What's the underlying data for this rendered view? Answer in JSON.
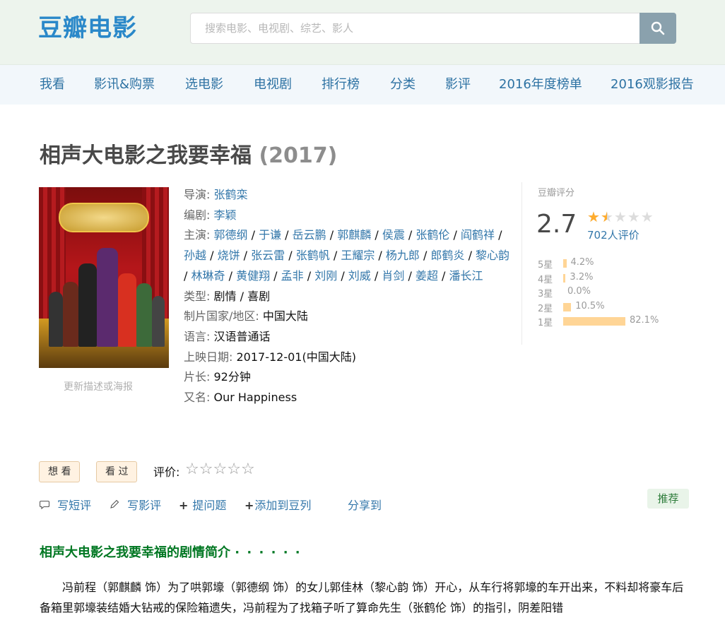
{
  "header": {
    "logo": "豆瓣电影",
    "search_placeholder": "搜索电影、电视剧、综艺、影人"
  },
  "nav": {
    "items": [
      "我看",
      "影讯&购票",
      "选电影",
      "电视剧",
      "排行榜",
      "分类",
      "影评",
      "2016年度榜单",
      "2016观影报告"
    ]
  },
  "movie": {
    "title": "相声大电影之我要幸福",
    "year": "(2017)",
    "update_link": "更新描述或海报"
  },
  "info": {
    "director_label": "导演",
    "director": "张鹤栾",
    "writer_label": "编剧",
    "writer": "李颖",
    "cast_label": "主演",
    "cast": [
      "郭德纲",
      "于谦",
      "岳云鹏",
      "郭麒麟",
      "侯震",
      "张鹤伦",
      "阎鹤祥",
      "孙越",
      "烧饼",
      "张云雷",
      "张鹤帆",
      "王耀宗",
      "杨九郎",
      "郎鹤炎",
      "黎心韵",
      "林琳奇",
      "黄健翔",
      "孟非",
      "刘刚",
      "刘威",
      "肖剑",
      "姜超",
      "潘长江"
    ],
    "genre_label": "类型:",
    "genre": "剧情 / 喜剧",
    "country_label": "制片国家/地区:",
    "country": "中国大陆",
    "language_label": "语言:",
    "language": "汉语普通话",
    "release_label": "上映日期:",
    "release": "2017-12-01(中国大陆)",
    "runtime_label": "片长:",
    "runtime": "92分钟",
    "aka_label": "又名:",
    "aka": "Our Happiness"
  },
  "rating": {
    "label": "豆瓣评分",
    "score": "2.7",
    "stars_value": 1.5,
    "stars_max": 5,
    "votes": "702人评价",
    "breakdown": [
      {
        "star": "5星",
        "pct": "4.2%",
        "value": 4.2
      },
      {
        "star": "4星",
        "pct": "3.2%",
        "value": 3.2
      },
      {
        "star": "3星",
        "pct": "0.0%",
        "value": 0.0
      },
      {
        "star": "2星",
        "pct": "10.5%",
        "value": 10.5
      },
      {
        "star": "1星",
        "pct": "82.1%",
        "value": 82.1
      }
    ]
  },
  "actions": {
    "want": "想 看",
    "seen": "看 过",
    "rate_label": "评价:",
    "short_review": "写短评",
    "review": "写影评",
    "question": "提问题",
    "doulist": "添加到豆列",
    "share": "分享到",
    "recommend": "推荐"
  },
  "synopsis": {
    "title": "相声大电影之我要幸福的剧情简介",
    "dots": "· · · · · ·",
    "text": "冯前程（郭麒麟 饰）为了哄郭壕（郭德纲 饰）的女儿郭佳林（黎心韵 饰）开心，从车行将郭壕的车开出来，不料却将豪车后备箱里郭壕装结婚大钻戒的保险箱遗失，冯前程为了找箱子听了算命先生（张鹤伦 饰）的指引，阴差阳错"
  },
  "colors": {
    "link": "#3377aa",
    "header_bg": "#edf4ed",
    "nav_bg": "#f2f7fb",
    "star": "#ffac2d",
    "bar": "#ffd596",
    "synopsis_title": "#007722"
  }
}
